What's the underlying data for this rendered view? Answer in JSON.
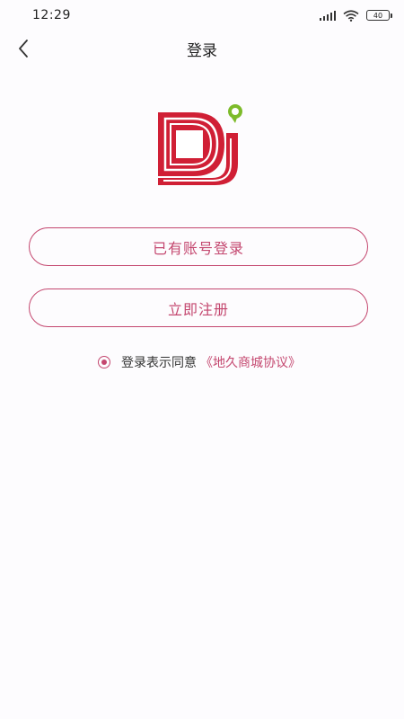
{
  "status_bar": {
    "time": "12:29",
    "battery": "40",
    "icons": [
      "signal-icon",
      "wifi-icon",
      "battery-icon"
    ]
  },
  "nav": {
    "title": "登录",
    "back_icon": "chevron-left-icon"
  },
  "logo": {
    "name": "dj-logo",
    "colors": {
      "primary": "#d01f35",
      "accent": "#7dbb2a"
    }
  },
  "actions": {
    "login_label": "已有账号登录",
    "register_label": "立即注册"
  },
  "agreement": {
    "text": "登录表示同意",
    "link": "《地久商城协议》",
    "checked": true
  },
  "theme": {
    "accent": "#c4476f",
    "background": "#fdfcfe"
  }
}
